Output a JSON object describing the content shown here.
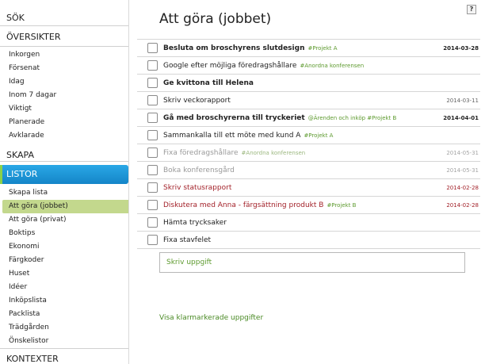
{
  "sidebar": {
    "search_label": "SÖK",
    "overview_label": "ÖVERSIKTER",
    "overview_items": [
      "Inkorgen",
      "Försenat",
      "Idag",
      "Inom 7 dagar",
      "Viktigt",
      "Planerade",
      "Avklarade"
    ],
    "create_label": "SKAPA",
    "lists_label": "LISTOR",
    "list_items": [
      "Skapa lista",
      "Att göra (jobbet)",
      "Att göra (privat)",
      "Boktips",
      "Ekonomi",
      "Färgkoder",
      "Huset",
      "Idéer",
      "Inköpslista",
      "Packlista",
      "Trädgården",
      "Önskelistor"
    ],
    "active_list": "Att göra (jobbet)",
    "contexts_label": "KONTEXTER"
  },
  "main": {
    "title": "Att göra (jobbet)",
    "help_label": "?",
    "tasks": [
      {
        "title": "Besluta om broschyrens slutdesign",
        "tags": "#Projekt A",
        "date": "2014-03-28",
        "style": "bold"
      },
      {
        "title": "Google efter möjliga föredragshållare",
        "tags": "#Anordna konferensen",
        "date": "",
        "style": "normal"
      },
      {
        "title": "Ge kvittona till Helena",
        "tags": "",
        "date": "",
        "style": "bold"
      },
      {
        "title": "Skriv veckorapport",
        "tags": "",
        "date": "2014-03-11",
        "style": "normal"
      },
      {
        "title": "Gå med broschyrerna till tryckeriet",
        "tags": "@Ärenden och inköp   #Projekt B",
        "date": "2014-04-01",
        "style": "bold"
      },
      {
        "title": "Sammankalla till ett möte med kund A",
        "tags": "#Projekt A",
        "date": "",
        "style": "normal"
      },
      {
        "title": "Fixa föredragshållare",
        "tags": "#Anordna konferensen",
        "date": "2014-05-31",
        "style": "faded"
      },
      {
        "title": "Boka konferensgård",
        "tags": "",
        "date": "2014-05-31",
        "style": "faded"
      },
      {
        "title": "Skriv statusrapport",
        "tags": "",
        "date": "2014-02-28",
        "style": "overdue"
      },
      {
        "title": "Diskutera med Anna - färgsättning produkt B",
        "tags": "#Projekt B",
        "date": "2014-02-28",
        "style": "overdue"
      },
      {
        "title": "Hämta trycksaker",
        "tags": "",
        "date": "",
        "style": "normal"
      },
      {
        "title": "Fixa stavfelet",
        "tags": "",
        "date": "",
        "style": "normal"
      }
    ],
    "new_task_placeholder": "Skriv uppgift",
    "show_completed_label": "Visa klarmarkerade uppgifter"
  },
  "colors": {
    "accent_blue": "#1c96d8",
    "active_item_green": "#c3d88d",
    "tag_green": "#5d9a2e",
    "overdue_red": "#a3222a"
  }
}
